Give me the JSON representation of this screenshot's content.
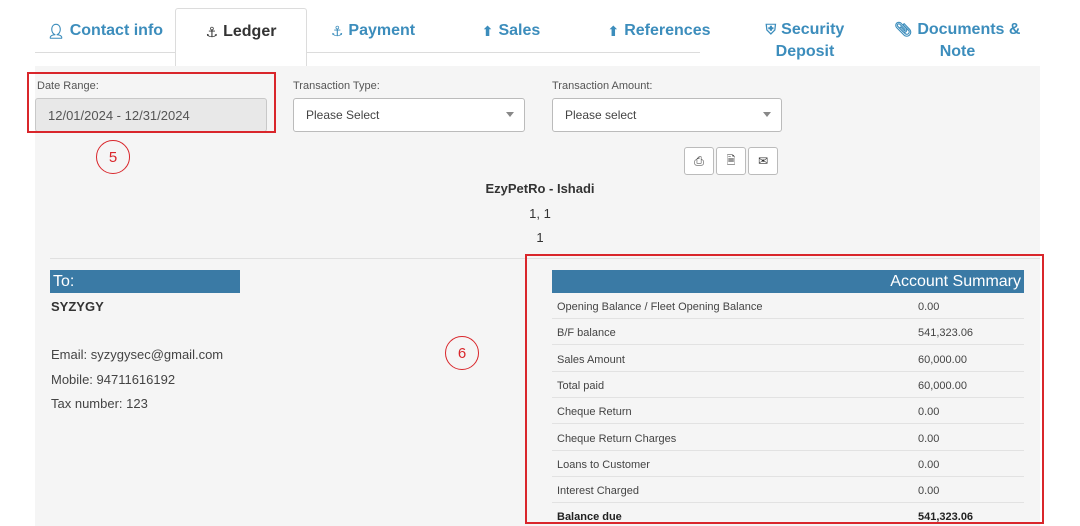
{
  "tabs": [
    {
      "label": "Contact info",
      "icon": "user-icon",
      "sub": ""
    },
    {
      "label": "Ledger",
      "icon": "anchor-icon",
      "sub": ""
    },
    {
      "label": "Payment",
      "icon": "anchor-icon",
      "sub": ""
    },
    {
      "label": "Sales",
      "icon": "arrow-up-circle-icon",
      "sub": ""
    },
    {
      "label": "References",
      "icon": "arrow-up-circle-icon",
      "sub": ""
    },
    {
      "label": "Security",
      "icon": "shield-icon",
      "sub": "Deposit"
    },
    {
      "label": "Documents &",
      "icon": "paperclip-icon",
      "sub": "Note"
    }
  ],
  "filters": {
    "date_range_label": "Date Range:",
    "date_range_value": "12/01/2024 - 12/31/2024",
    "transaction_type_label": "Transaction Type:",
    "transaction_type_value": "Please Select",
    "transaction_amount_label": "Transaction Amount:",
    "transaction_amount_value": "Please select"
  },
  "annotations": {
    "five": "5",
    "six": "6"
  },
  "company": {
    "name": "EzyPetRo - Ishadi",
    "line1": "1, 1",
    "line2": "1"
  },
  "to": {
    "heading": "To:",
    "name": "SYZYGY",
    "email": "Email: syzygysec@gmail.com",
    "mobile": "Mobile: 94711616192",
    "tax": "Tax number: 123"
  },
  "summary": {
    "heading": "Account Summary",
    "rows": [
      {
        "label": "Opening Balance / Fleet Opening Balance",
        "value": "0.00"
      },
      {
        "label": "B/F balance",
        "value": "541,323.06"
      },
      {
        "label": "Sales Amount",
        "value": "60,000.00"
      },
      {
        "label": "Total paid",
        "value": "60,000.00"
      },
      {
        "label": "Cheque Return",
        "value": "0.00"
      },
      {
        "label": "Cheque Return Charges",
        "value": "0.00"
      },
      {
        "label": "Loans to Customer",
        "value": "0.00"
      },
      {
        "label": "Interest Charged",
        "value": "0.00"
      },
      {
        "label": "Balance due",
        "value": "541,323.06"
      }
    ]
  },
  "colors": {
    "accent": "#3c8dbc",
    "header_bar": "#3a7aa5",
    "annotation_red": "#d9262b"
  }
}
